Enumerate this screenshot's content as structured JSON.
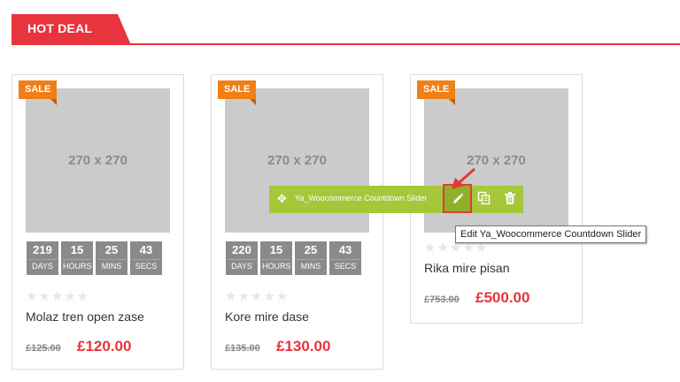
{
  "section": {
    "title": "HOT DEAL",
    "accent": "#e8343d"
  },
  "products": [
    {
      "badge": "SALE",
      "image_label": "270 x 270",
      "countdown": [
        {
          "value": "219",
          "unit": "DAYS"
        },
        {
          "value": "15",
          "unit": "HOURS"
        },
        {
          "value": "25",
          "unit": "MINS"
        },
        {
          "value": "43",
          "unit": "SECS"
        }
      ],
      "rating_stars": "★★★★★",
      "name": "Molaz tren open zase",
      "old_price": "£125.00",
      "price": "£120.00"
    },
    {
      "badge": "SALE",
      "image_label": "270 x 270",
      "countdown": [
        {
          "value": "220",
          "unit": "DAYS"
        },
        {
          "value": "15",
          "unit": "HOURS"
        },
        {
          "value": "25",
          "unit": "MINS"
        },
        {
          "value": "43",
          "unit": "SECS"
        }
      ],
      "rating_stars": "★★★★★",
      "name": "Kore mire dase",
      "old_price": "£135.00",
      "price": "£130.00"
    },
    {
      "badge": "SALE",
      "image_label": "270 x 270",
      "rating_stars": "★★★★★",
      "name": "Rika mire pisan",
      "old_price": "£753.00",
      "price": "£500.00"
    }
  ],
  "widget_toolbar": {
    "label": "Ya_Woocommerce Countdown Slider",
    "color": "#a6c73a",
    "icons": [
      "move-icon",
      "edit-pencil-icon",
      "duplicate-icon",
      "trash-icon"
    ],
    "tooltip": "Edit Ya_Woocommerce Countdown Slider"
  }
}
